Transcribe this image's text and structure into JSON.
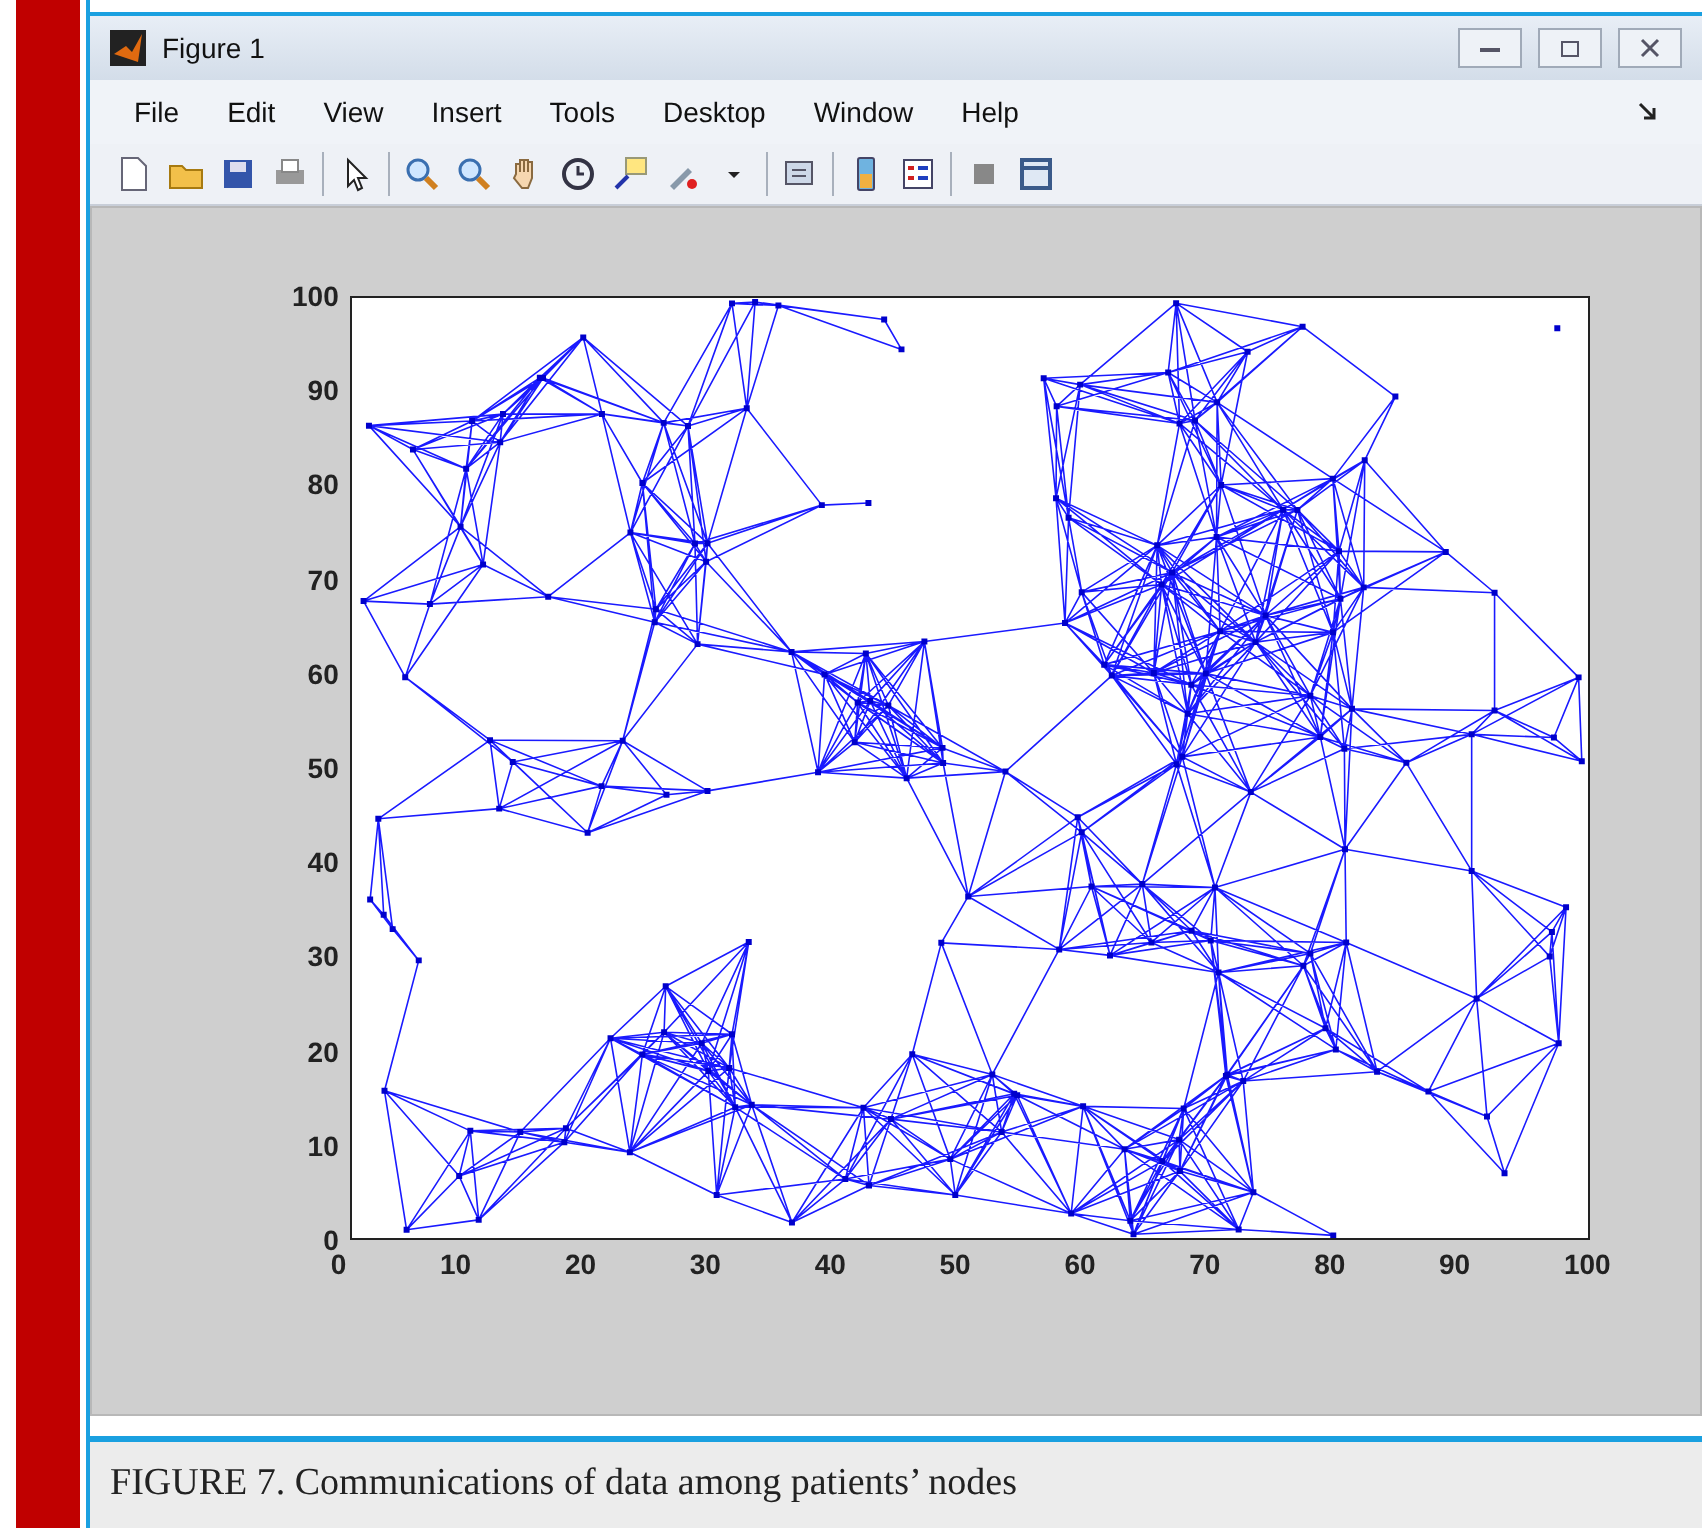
{
  "window": {
    "title": "Figure 1"
  },
  "menu": [
    "File",
    "Edit",
    "View",
    "Insert",
    "Tools",
    "Desktop",
    "Window",
    "Help"
  ],
  "axes": {
    "xticks": [
      "0",
      "10",
      "20",
      "30",
      "40",
      "50",
      "60",
      "70",
      "80",
      "90",
      "100"
    ],
    "yticks": [
      "100",
      "90",
      "80",
      "70",
      "60",
      "50",
      "40",
      "30",
      "20",
      "10",
      "0"
    ]
  },
  "caption": "FIGURE 7. Communications of data among patients’ nodes"
}
